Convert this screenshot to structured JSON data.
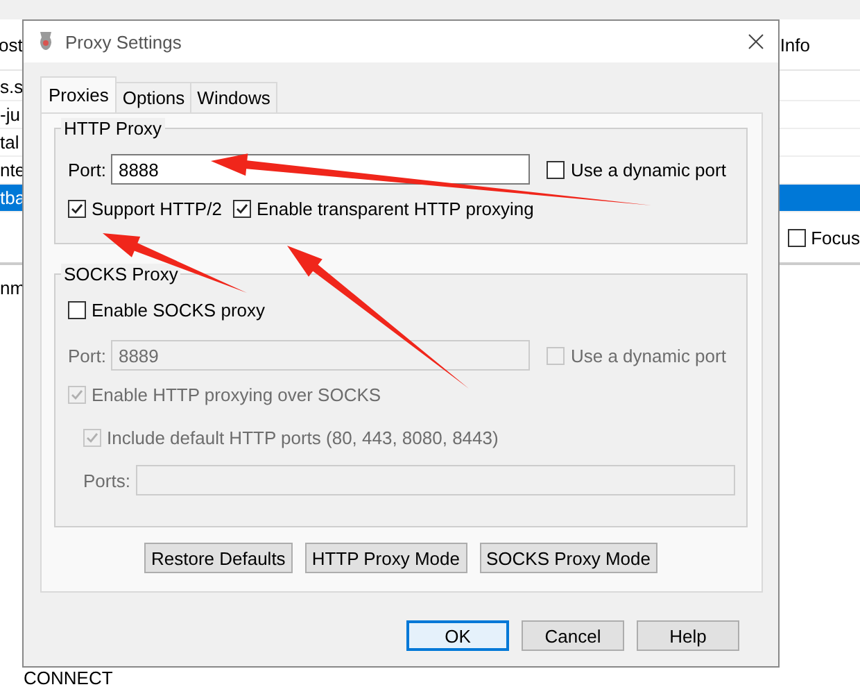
{
  "background": {
    "header_left": "ost",
    "header_right": "Info",
    "rows": [
      {
        "text": "s.s",
        "selected": false
      },
      {
        "text": "-ju",
        "selected": false
      },
      {
        "text": "tal",
        "selected": false
      },
      {
        "text": "nte",
        "selected": false
      },
      {
        "text": "tba",
        "selected": true
      }
    ],
    "focus": {
      "label": "Focus",
      "checked": false
    },
    "panel_text": "nm",
    "footer_text": "CONNECT"
  },
  "dialog": {
    "title": "Proxy Settings",
    "tabs": [
      {
        "label": "Proxies",
        "selected": true
      },
      {
        "label": "Options",
        "selected": false
      },
      {
        "label": "Windows",
        "selected": false
      }
    ],
    "http_proxy": {
      "title": "HTTP Proxy",
      "port_label": "Port:",
      "port_value": "8888",
      "dynamic_port": {
        "label": "Use a dynamic port",
        "checked": false,
        "disabled": false
      },
      "options": [
        {
          "label": "Support HTTP/2",
          "checked": true,
          "disabled": false
        },
        {
          "label": "Enable transparent HTTP proxying",
          "checked": true,
          "disabled": false
        }
      ]
    },
    "socks_proxy": {
      "title": "SOCKS Proxy",
      "enable": {
        "label": "Enable SOCKS proxy",
        "checked": false,
        "disabled": false
      },
      "port_label": "Port:",
      "port_value": "8889",
      "port_disabled": true,
      "dynamic_port": {
        "label": "Use a dynamic port",
        "checked": false,
        "disabled": true
      },
      "http_over_socks": {
        "label": "Enable HTTP proxying over SOCKS",
        "checked": true,
        "disabled": true
      },
      "include_ports": {
        "label": "Include default HTTP ports (80, 443, 8080, 8443)",
        "checked": true,
        "disabled": true
      },
      "ports_label": "Ports:",
      "ports_disabled": true
    },
    "mode_buttons": [
      "Restore Defaults",
      "HTTP Proxy Mode",
      "SOCKS Proxy Mode"
    ],
    "buttons": [
      {
        "label": "OK",
        "default": true
      },
      {
        "label": "Cancel",
        "default": false
      },
      {
        "label": "Help",
        "default": false
      }
    ]
  }
}
